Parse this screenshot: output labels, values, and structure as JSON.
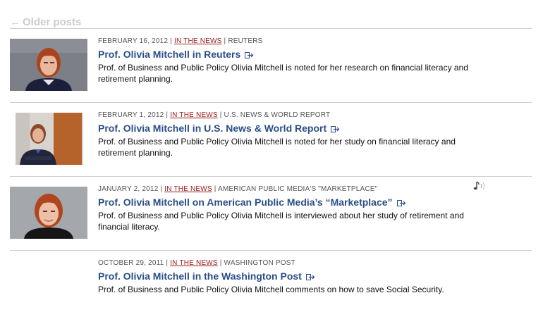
{
  "nav": {
    "older_label": "Older posts",
    "older_arrow": "←"
  },
  "colors": {
    "link": "#2a4e88",
    "category": "#9a1b1b",
    "meta": "#555555",
    "muted": "#cccccc"
  },
  "posts": [
    {
      "date": "FEBRUARY 16, 2012",
      "category": "IN THE NEWS",
      "source": "REUTERS",
      "title": "Prof. Olivia Mitchell in Reuters",
      "description": "Prof. of Business and Public Policy Olivia Mitchell is noted for her research on financial literacy and retirement planning.",
      "thumbnail": "portrait-photo",
      "external_icon": "external-link-icon"
    },
    {
      "date": "FEBRUARY 1, 2012",
      "category": "IN THE NEWS",
      "source": "U.S. NEWS & WORLD REPORT",
      "title": "Prof. Olivia Mitchell in U.S. News & World Report",
      "description": "Prof. of Business and Public Policy Olivia Mitchell is noted for her study on financial literacy and retirement planning.",
      "thumbnail": "portrait-photo",
      "external_icon": "external-link-icon"
    },
    {
      "date": "JANUARY 2, 2012",
      "category": "IN THE NEWS",
      "source": "AMERICAN PUBLIC MEDIA'S \"MARKETPLACE\"",
      "title": "Prof. Olivia Mitchell on American Public Media’s “Marketplace”",
      "description": "Prof. of Business and Public Policy Olivia Mitchell is interviewed about her study of retirement and financial literacy.",
      "thumbnail": "portrait-photo",
      "external_icon": "external-link-icon",
      "media_icon": "audio-icon"
    },
    {
      "date": "OCTOBER 29, 2011",
      "category": "IN THE NEWS",
      "source": "WASHINGTON POST",
      "title": "Prof. Olivia Mitchell in the Washington Post",
      "description": "Prof. of Business and Public Policy Olivia Mitchell comments on how to save Social Security.",
      "external_icon": "external-link-icon"
    }
  ]
}
